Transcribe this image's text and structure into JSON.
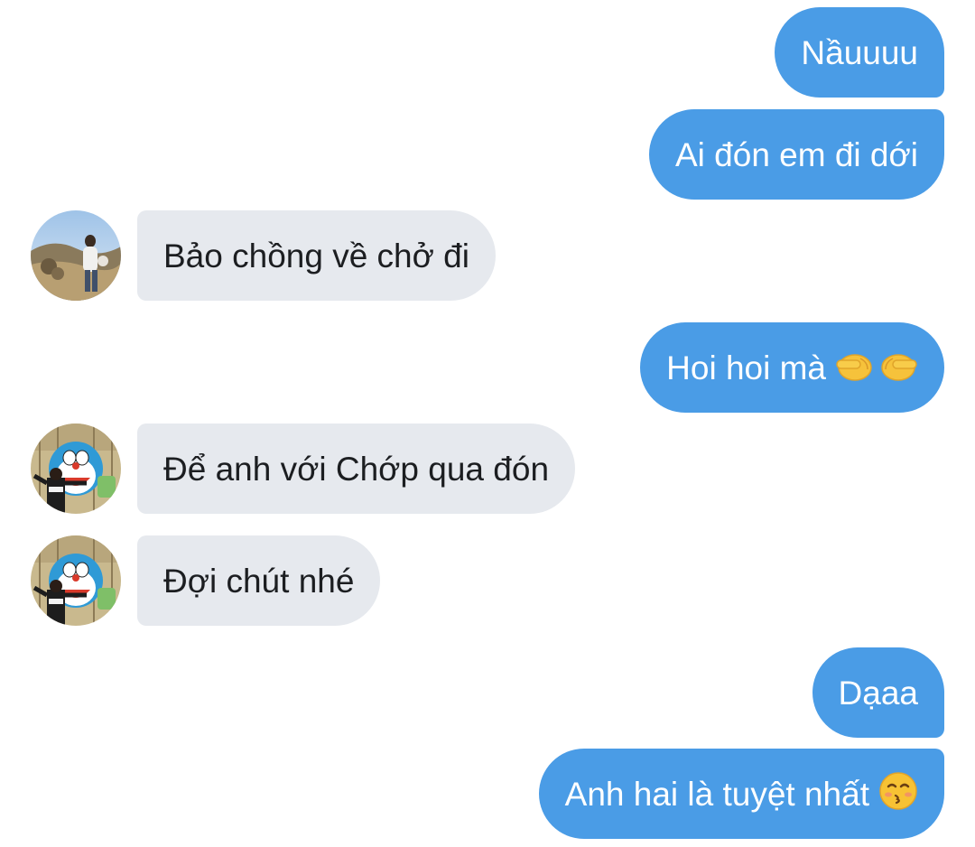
{
  "conversation": {
    "messages": [
      {
        "id": "m1",
        "direction": "outgoing",
        "text": "Nầuuuu"
      },
      {
        "id": "m2",
        "direction": "outgoing",
        "text": "Ai đón em đi dới"
      },
      {
        "id": "m3",
        "direction": "incoming",
        "text": "Bảo chồng về chở đi",
        "avatar": "avatar-field-person"
      },
      {
        "id": "m4",
        "direction": "outgoing",
        "text": "Hoi hoi mà",
        "emoji": "pointing-fingers-emoji"
      },
      {
        "id": "m5",
        "direction": "incoming",
        "text": "Để anh với Chớp qua đón",
        "avatar": "avatar-doraemon-person"
      },
      {
        "id": "m6",
        "direction": "incoming",
        "text": "Đợi chút nhé",
        "avatar": "avatar-doraemon-person"
      },
      {
        "id": "m7",
        "direction": "outgoing",
        "text": "Dạaa"
      },
      {
        "id": "m8",
        "direction": "outgoing",
        "text": "Anh hai là tuyệt nhất",
        "emoji": "kissing-face-emoji"
      }
    ]
  },
  "colors": {
    "outgoing_bubble": "#4a9ce6",
    "incoming_bubble": "#e6e9ee",
    "outgoing_text": "#ffffff",
    "incoming_text": "#1c1e21"
  }
}
